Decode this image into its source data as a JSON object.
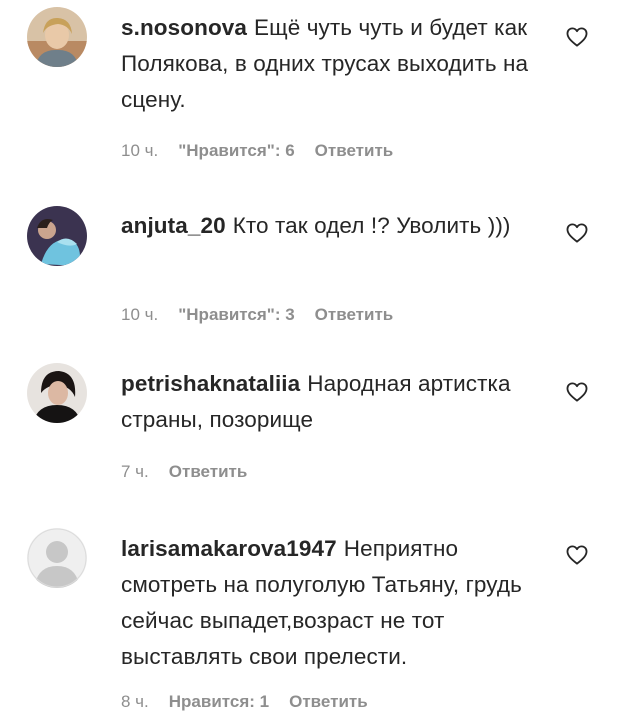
{
  "comments": [
    {
      "username": "s.nosonova",
      "text": "Ещё чуть чуть и будет как Полякова, в одних трусах выходить на сцену.",
      "time": "10 ч.",
      "likes": "\"Нравится\": 6",
      "reply": "Ответить",
      "avatar": "avatar-photo"
    },
    {
      "username": "anjuta_20",
      "text": "Кто так одел !? Уволить )))",
      "time": "10 ч.",
      "likes": "\"Нравится\": 3",
      "reply": "Ответить",
      "avatar": "avatar-photo"
    },
    {
      "username": "petrishaknataliia",
      "text": "Народная артистка страны, позорище",
      "time": "7 ч.",
      "reply": "Ответить",
      "avatar": "avatar-photo"
    },
    {
      "username": "larisamakarova1947",
      "text": "Неприятно смотреть на полуголую Татьяну, грудь сейчас выпадет,возраст не тот выставлять свои прелести.",
      "time": "8 ч.",
      "likes": "Нравится: 1",
      "reply": "Ответить",
      "avatar": "default-avatar-icon"
    }
  ],
  "icons": {
    "like": "heart-outline-icon"
  },
  "colors": {
    "text": "#262626",
    "secondary": "#8e8e8e",
    "background": "#ffffff"
  }
}
